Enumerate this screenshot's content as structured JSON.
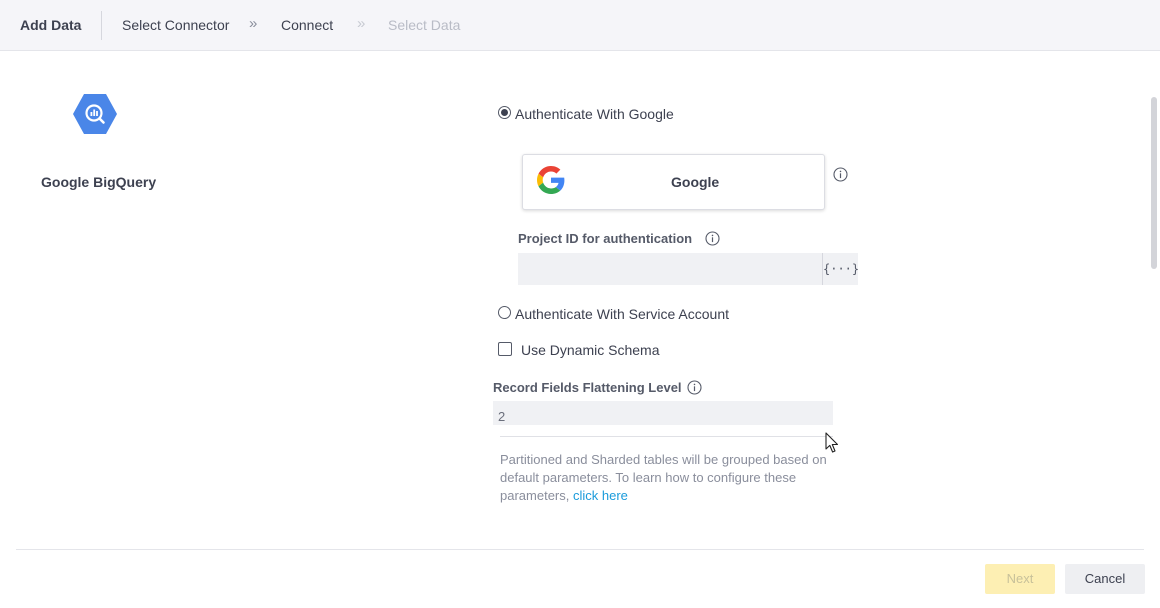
{
  "header": {
    "title": "Add Data",
    "breadcrumbs": [
      {
        "label": "Select Connector",
        "state": "done"
      },
      {
        "label": "Connect",
        "state": "active"
      },
      {
        "label": "Select Data",
        "state": "disabled"
      }
    ],
    "separator": "»"
  },
  "connector": {
    "name": "Google BigQuery",
    "icon": "bigquery-icon",
    "color": "#4a86e8"
  },
  "auth": {
    "google_option_label": "Authenticate With Google",
    "google_selected": true,
    "google_button_label": "Google",
    "project_id_label": "Project ID for authentication",
    "project_id_value": "",
    "variable_button_label": "{···}",
    "service_account_label": "Authenticate With Service Account"
  },
  "dynamic_schema": {
    "label": "Use Dynamic Schema",
    "checked": false
  },
  "flattening": {
    "label": "Record Fields Flattening Level",
    "value": "2"
  },
  "help": {
    "text": "Partitioned and Sharded tables will be grouped based on default parameters. To learn how to configure these parameters,",
    "link_label": "click here"
  },
  "footer": {
    "next_label": "Next",
    "cancel_label": "Cancel"
  },
  "colors": {
    "accent_link": "#1a9bdb",
    "next_disabled_bg": "#fdefb3"
  }
}
